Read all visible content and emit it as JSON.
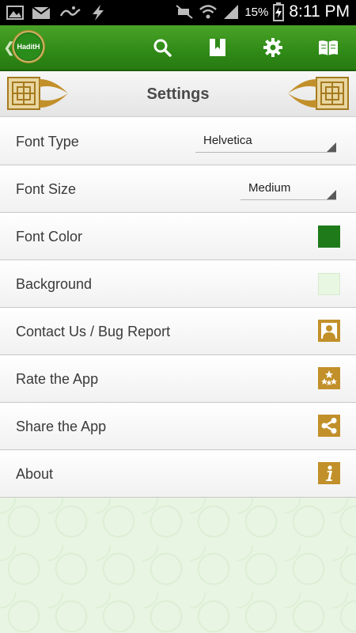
{
  "status_bar": {
    "battery_percent": "15%",
    "time": "8:11 PM",
    "left_icons": [
      "image-icon",
      "mail-icon",
      "notification-icon",
      "flash-icon"
    ],
    "right_icons": [
      "mute-icon",
      "wifi-icon",
      "signal-icon",
      "battery-charging-icon"
    ]
  },
  "app_bar": {
    "logo_text": "HaditH",
    "actions": [
      "search-icon",
      "bookmark-icon",
      "settings-icon",
      "book-icon"
    ],
    "colors": {
      "bar": "#2f8a17",
      "logo_ring": "#b08a2a"
    }
  },
  "header": {
    "title": "Settings"
  },
  "settings": {
    "font_type": {
      "label": "Font Type",
      "value": "Helvetica"
    },
    "font_size": {
      "label": "Font Size",
      "value": "Medium"
    },
    "font_color": {
      "label": "Font Color",
      "color": "#1f7a1a"
    },
    "background": {
      "label": "Background",
      "color": "#e8f7e2"
    },
    "contact": {
      "label": "Contact Us / Bug Report",
      "icon": "person-icon"
    },
    "rate": {
      "label": "Rate the App",
      "icon": "stars-icon"
    },
    "share": {
      "label": "Share the App",
      "icon": "share-icon"
    },
    "about": {
      "label": "About",
      "icon": "info-icon"
    }
  },
  "accent_color": "#c2902a"
}
